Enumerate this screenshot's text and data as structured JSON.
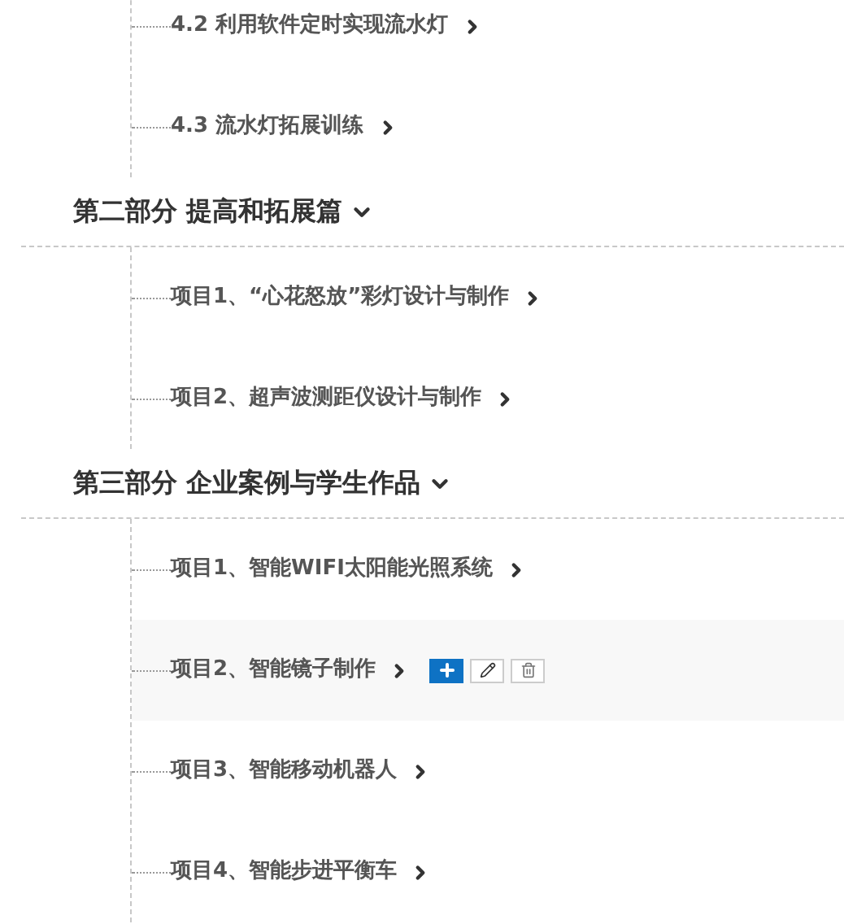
{
  "sections": [
    {
      "items": [
        {
          "label": "4.2 利用软件定时实现流水灯",
          "highlighted": false
        },
        {
          "label": "4.3 流水灯拓展训练",
          "highlighted": false
        }
      ]
    },
    {
      "title": "第二部分 提高和拓展篇",
      "expanded": true,
      "items": [
        {
          "label": "项目1、“心花怒放”彩灯设计与制作",
          "highlighted": false
        },
        {
          "label": "项目2、超声波测距仪设计与制作",
          "highlighted": false
        }
      ]
    },
    {
      "title": "第三部分 企业案例与学生作品",
      "expanded": true,
      "items": [
        {
          "label": "项目1、智能WIFI太阳能光照系统",
          "highlighted": false
        },
        {
          "label": "项目2、智能镜子制作",
          "highlighted": true
        },
        {
          "label": "项目3、智能移动机器人",
          "highlighted": false
        },
        {
          "label": "项目4、智能步进平衡车",
          "highlighted": false
        }
      ]
    }
  ]
}
